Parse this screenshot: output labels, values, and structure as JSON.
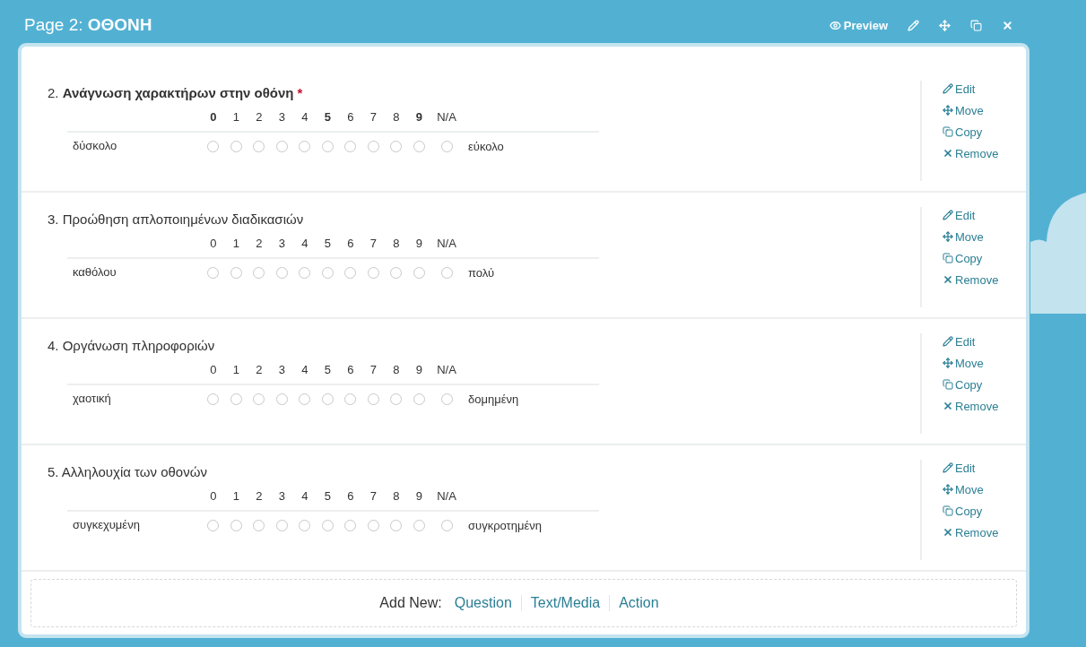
{
  "page": {
    "title": "Page 2: **ΟΘΟΝΗ**",
    "tools": [
      {
        "kind": "preview",
        "label": "Preview"
      },
      {
        "kind": "edit"
      },
      {
        "kind": "move"
      },
      {
        "kind": "copy"
      },
      {
        "kind": "remove"
      }
    ]
  },
  "questions": [
    {
      "number": "2.",
      "title": "Ανάγνωση χαρακτήρων στην οθόνη",
      "bold": true,
      "required_mark": "*",
      "low_label": "δύσκολο",
      "high_label": "εύκολο",
      "options": [
        {
          "kind": "value",
          "label": "0",
          "bold": true,
          "selected": false
        },
        {
          "kind": "value",
          "label": "1",
          "bold": false,
          "selected": false
        },
        {
          "kind": "value",
          "label": "2",
          "bold": false,
          "selected": false
        },
        {
          "kind": "value",
          "label": "3",
          "bold": false,
          "selected": false
        },
        {
          "kind": "value",
          "label": "4",
          "bold": false,
          "selected": false
        },
        {
          "kind": "value",
          "label": "5",
          "bold": true,
          "selected": false
        },
        {
          "kind": "value",
          "label": "6",
          "bold": false,
          "selected": false
        },
        {
          "kind": "value",
          "label": "7",
          "bold": false,
          "selected": false
        },
        {
          "kind": "value",
          "label": "8",
          "bold": false,
          "selected": false
        },
        {
          "kind": "value",
          "label": "9",
          "bold": true,
          "selected": false
        },
        {
          "kind": "na",
          "label": "N/A",
          "bold": false,
          "selected": false
        }
      ],
      "actions": [
        {
          "kind": "edit",
          "label": "Edit"
        },
        {
          "kind": "move",
          "label": "Move"
        },
        {
          "kind": "copy",
          "label": "Copy"
        },
        {
          "kind": "remove",
          "label": "Remove"
        }
      ]
    },
    {
      "number": "3.",
      "title": "Προώθηση απλοποιημένων διαδικασιών",
      "bold": false,
      "low_label": "καθόλου",
      "high_label": "πολύ",
      "options": [
        {
          "kind": "value",
          "label": "0",
          "bold": false,
          "selected": false
        },
        {
          "kind": "value",
          "label": "1",
          "bold": false,
          "selected": false
        },
        {
          "kind": "value",
          "label": "2",
          "bold": false,
          "selected": false
        },
        {
          "kind": "value",
          "label": "3",
          "bold": false,
          "selected": false
        },
        {
          "kind": "value",
          "label": "4",
          "bold": false,
          "selected": false
        },
        {
          "kind": "value",
          "label": "5",
          "bold": false,
          "selected": false
        },
        {
          "kind": "value",
          "label": "6",
          "bold": false,
          "selected": false
        },
        {
          "kind": "value",
          "label": "7",
          "bold": false,
          "selected": false
        },
        {
          "kind": "value",
          "label": "8",
          "bold": false,
          "selected": false
        },
        {
          "kind": "value",
          "label": "9",
          "bold": false,
          "selected": false
        },
        {
          "kind": "na",
          "label": "N/A",
          "bold": false,
          "selected": false
        }
      ],
      "actions": [
        {
          "kind": "edit",
          "label": "Edit"
        },
        {
          "kind": "move",
          "label": "Move"
        },
        {
          "kind": "copy",
          "label": "Copy"
        },
        {
          "kind": "remove",
          "label": "Remove"
        }
      ]
    },
    {
      "number": "4.",
      "title": "Οργάνωση πληροφοριών",
      "bold": false,
      "low_label": "χαοτική",
      "high_label": "δομημένη",
      "options": [
        {
          "kind": "value",
          "label": "0",
          "bold": false,
          "selected": false
        },
        {
          "kind": "value",
          "label": "1",
          "bold": false,
          "selected": false
        },
        {
          "kind": "value",
          "label": "2",
          "bold": false,
          "selected": false
        },
        {
          "kind": "value",
          "label": "3",
          "bold": false,
          "selected": false
        },
        {
          "kind": "value",
          "label": "4",
          "bold": false,
          "selected": false
        },
        {
          "kind": "value",
          "label": "5",
          "bold": false,
          "selected": false
        },
        {
          "kind": "value",
          "label": "6",
          "bold": false,
          "selected": false
        },
        {
          "kind": "value",
          "label": "7",
          "bold": false,
          "selected": false
        },
        {
          "kind": "value",
          "label": "8",
          "bold": false,
          "selected": false
        },
        {
          "kind": "value",
          "label": "9",
          "bold": false,
          "selected": false
        },
        {
          "kind": "na",
          "label": "N/A",
          "bold": false,
          "selected": false
        }
      ],
      "actions": [
        {
          "kind": "edit",
          "label": "Edit"
        },
        {
          "kind": "move",
          "label": "Move"
        },
        {
          "kind": "copy",
          "label": "Copy"
        },
        {
          "kind": "remove",
          "label": "Remove"
        }
      ]
    },
    {
      "number": "5.",
      "title": "Αλληλουχία των οθονών",
      "bold": false,
      "low_label": "συγκεχυμένη",
      "high_label": "συγκροτημένη",
      "options": [
        {
          "kind": "value",
          "label": "0",
          "bold": false,
          "selected": false
        },
        {
          "kind": "value",
          "label": "1",
          "bold": false,
          "selected": false
        },
        {
          "kind": "value",
          "label": "2",
          "bold": false,
          "selected": false
        },
        {
          "kind": "value",
          "label": "3",
          "bold": false,
          "selected": false
        },
        {
          "kind": "value",
          "label": "4",
          "bold": false,
          "selected": false
        },
        {
          "kind": "value",
          "label": "5",
          "bold": false,
          "selected": false
        },
        {
          "kind": "value",
          "label": "6",
          "bold": false,
          "selected": false
        },
        {
          "kind": "value",
          "label": "7",
          "bold": false,
          "selected": false
        },
        {
          "kind": "value",
          "label": "8",
          "bold": false,
          "selected": false
        },
        {
          "kind": "value",
          "label": "9",
          "bold": false,
          "selected": false
        },
        {
          "kind": "na",
          "label": "N/A",
          "bold": false,
          "selected": false
        }
      ],
      "actions": [
        {
          "kind": "edit",
          "label": "Edit"
        },
        {
          "kind": "move",
          "label": "Move"
        },
        {
          "kind": "copy",
          "label": "Copy"
        },
        {
          "kind": "remove",
          "label": "Remove"
        }
      ]
    }
  ],
  "add_new": {
    "label": "Add New:",
    "links": [
      "Question",
      "Text/Media",
      "Action"
    ]
  }
}
